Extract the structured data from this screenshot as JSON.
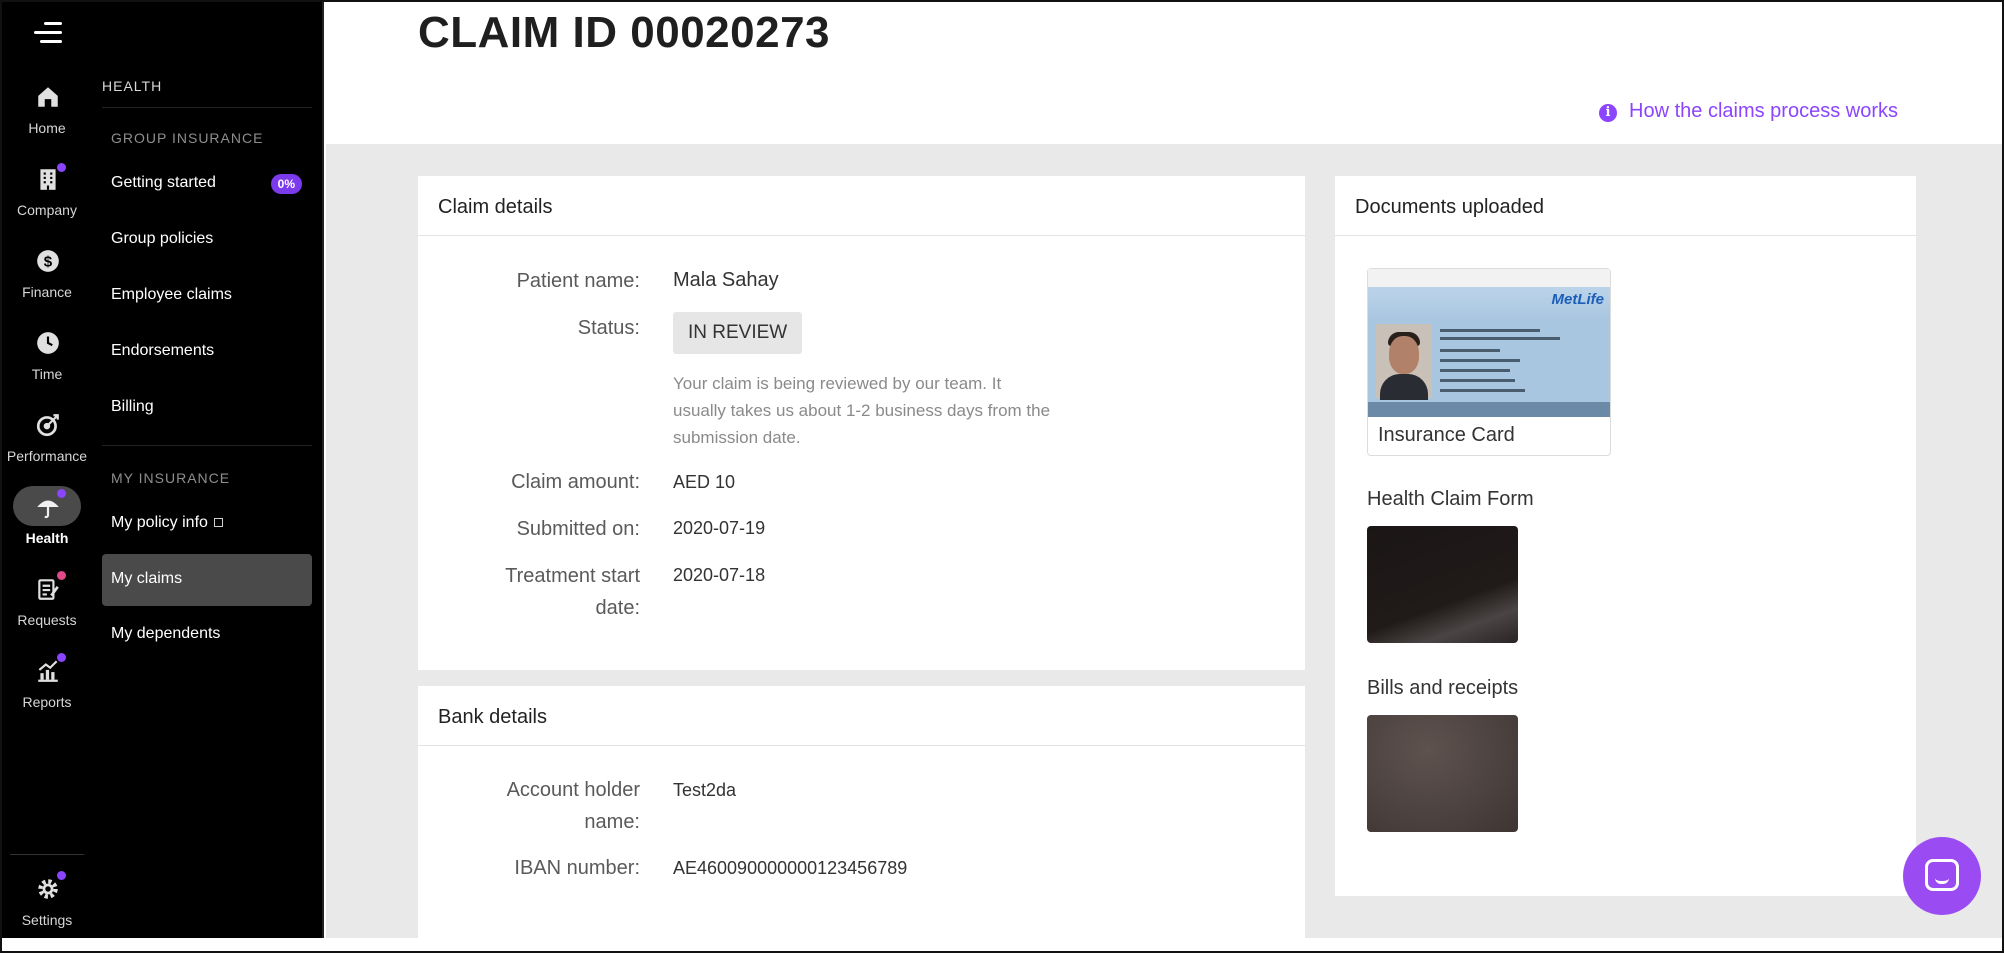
{
  "rail": {
    "items": [
      {
        "label": "Home",
        "icon": "home-icon",
        "dot": ""
      },
      {
        "label": "Company",
        "icon": "building-icon",
        "dot": "purple"
      },
      {
        "label": "Finance",
        "icon": "dollar-icon",
        "dot": ""
      },
      {
        "label": "Time",
        "icon": "clock-icon",
        "dot": ""
      },
      {
        "label": "Performance",
        "icon": "target-icon",
        "dot": ""
      },
      {
        "label": "Health",
        "icon": "health-umbrella-icon",
        "dot": "purple",
        "active": true
      },
      {
        "label": "Requests",
        "icon": "clipboard-icon",
        "dot": "pink"
      },
      {
        "label": "Reports",
        "icon": "chart-icon",
        "dot": "purple"
      }
    ],
    "settings": {
      "label": "Settings",
      "icon": "gear-icon",
      "dot": "purple"
    }
  },
  "subnav": {
    "section_title": "HEALTH",
    "group_insurance_title": "GROUP INSURANCE",
    "group_items": [
      {
        "label": "Getting started",
        "badge": "0%"
      },
      {
        "label": "Group policies"
      },
      {
        "label": "Employee claims"
      },
      {
        "label": "Endorsements"
      },
      {
        "label": "Billing"
      }
    ],
    "my_insurance_title": "MY INSURANCE",
    "my_items": [
      {
        "label": "My policy info",
        "external": true
      },
      {
        "label": "My claims",
        "active": true
      },
      {
        "label": "My dependents"
      }
    ]
  },
  "header": {
    "title": "CLAIM ID 00020273",
    "help_link": "How the claims process works"
  },
  "claim_details": {
    "heading": "Claim details",
    "patient_label": "Patient name:",
    "patient_value": "Mala Sahay",
    "status_label": "Status:",
    "status_value": "IN REVIEW",
    "status_note": "Your claim is being reviewed by our team. It usually takes us about 1-2 business days from the submission date.",
    "amount_label": "Claim amount:",
    "amount_value": "AED 10",
    "submitted_label": "Submitted on:",
    "submitted_value": "2020-07-19",
    "treatment_label": "Treatment start date:",
    "treatment_value": "2020-07-18"
  },
  "bank_details": {
    "heading": "Bank details",
    "holder_label": "Account holder name:",
    "holder_value": "Test2da",
    "iban_label": "IBAN number:",
    "iban_value": "AE460090000000123456789"
  },
  "documents": {
    "heading": "Documents uploaded",
    "insurance_card": {
      "caption": "Insurance Card",
      "logo": "MetLife"
    },
    "health_claim_form": {
      "label": "Health Claim Form"
    },
    "bills": {
      "label": "Bills and receipts"
    }
  },
  "colors": {
    "accent": "#8b45ff",
    "sidebar_bg": "#000000",
    "active_item_bg": "#4a4a4a",
    "content_bg": "#e9e9e9"
  }
}
